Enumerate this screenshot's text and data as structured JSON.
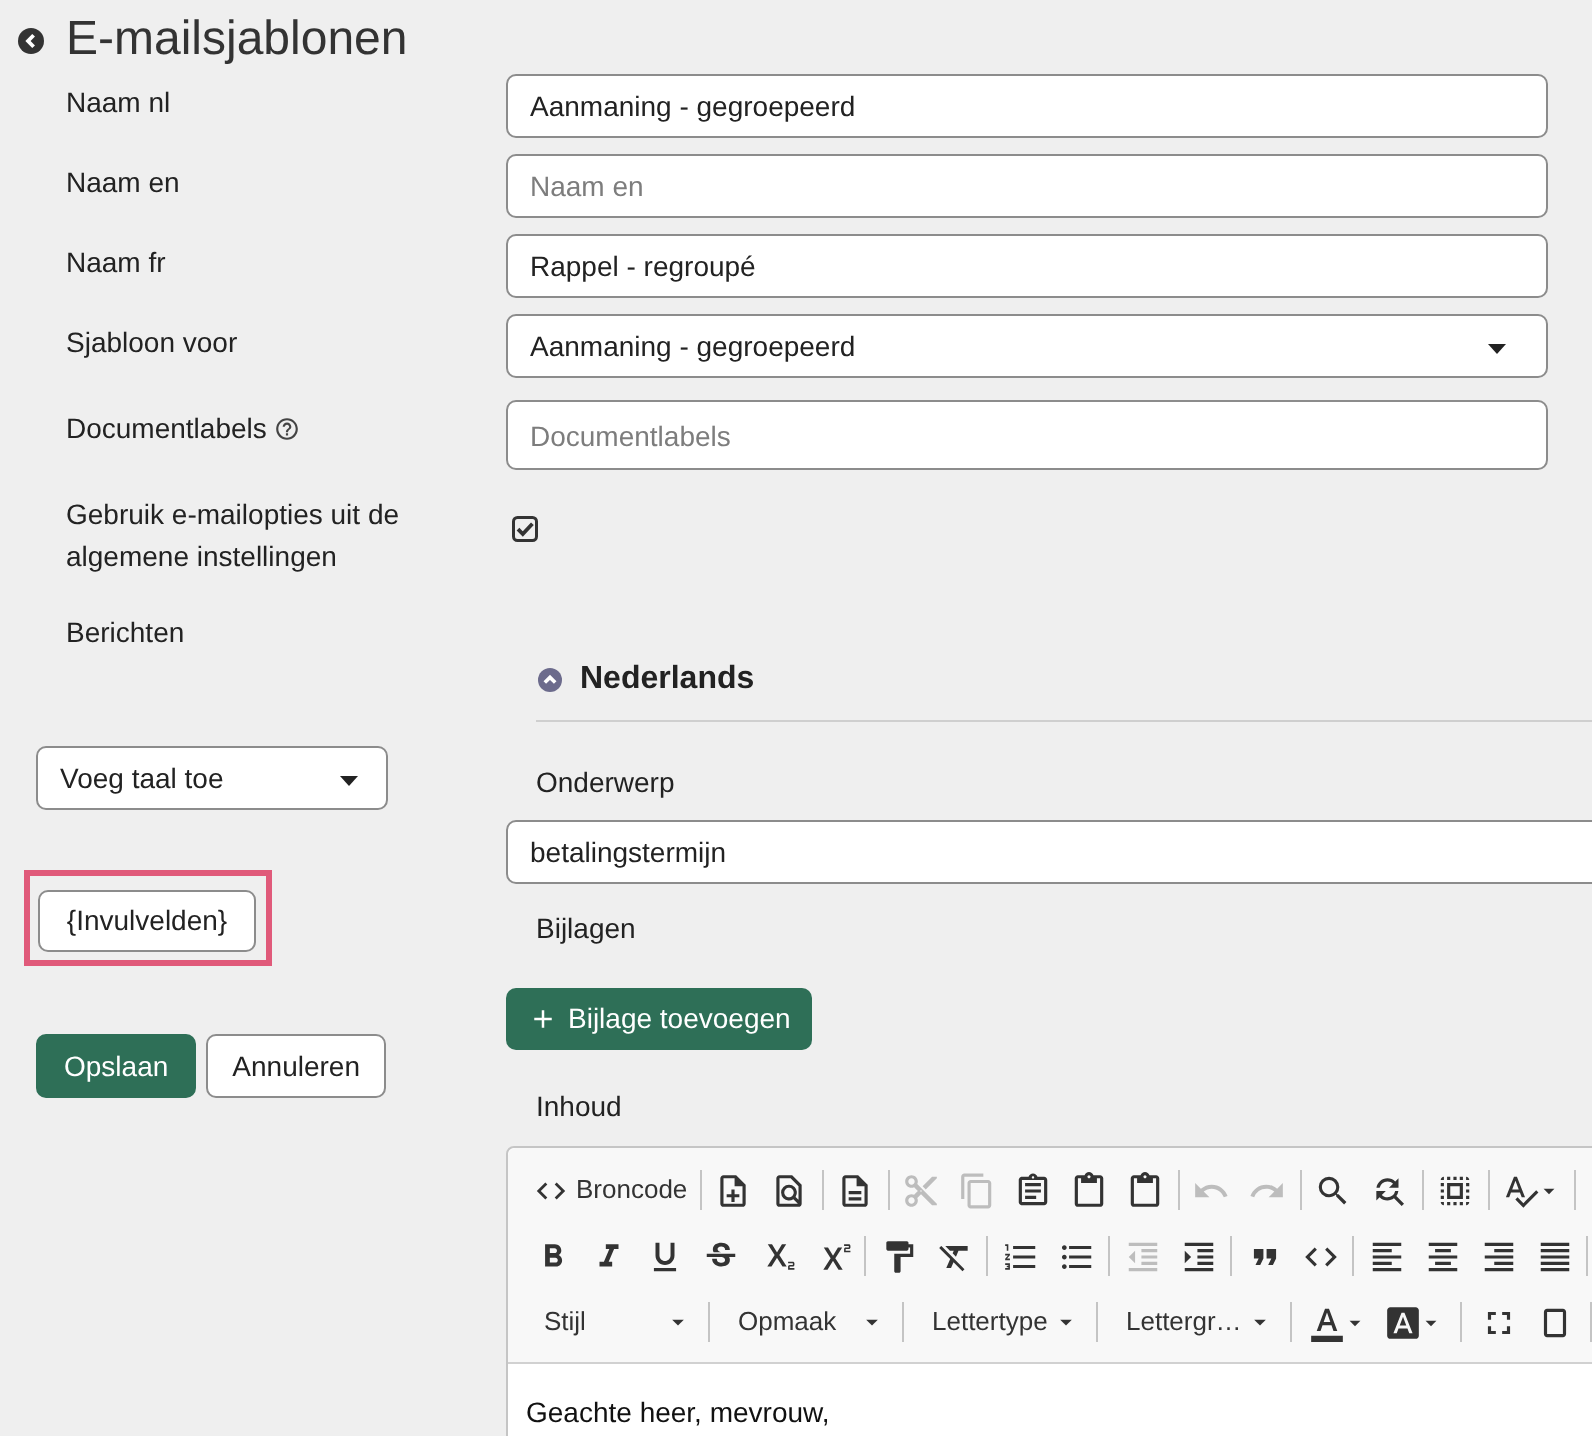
{
  "page": {
    "title": "E-mailsjablonen"
  },
  "form": {
    "fields": [
      {
        "kind": "text",
        "label": "Naam nl",
        "value": "Aanmaning - gegroepeerd"
      },
      {
        "kind": "text",
        "label": "Naam en",
        "placeholder": "Naam en"
      },
      {
        "kind": "text",
        "label": "Naam fr",
        "value": "Rappel - regroupé"
      },
      {
        "kind": "select",
        "label": "Sjabloon voor",
        "value": "Aanmaning - gegroepeerd"
      },
      {
        "kind": "tags",
        "label": "Documentlabels",
        "help": true,
        "placeholder": "Documentlabels"
      },
      {
        "kind": "checkbox",
        "label": "Gebruik e-mailopties uit de algemene instellingen",
        "checked": true
      }
    ],
    "messages_label": "Berichten"
  },
  "sidebar": {
    "language_select": {
      "value": "Voeg taal toe"
    },
    "placeholders_button": {
      "label": "{Invulvelden}",
      "highlighted": true
    },
    "actions": [
      {
        "kind": "primary",
        "label": "Opslaan"
      },
      {
        "kind": "secondary",
        "label": "Annuleren"
      }
    ]
  },
  "language_panel": {
    "title": "Nederlands",
    "expanded": true,
    "subject": {
      "label": "Onderwerp",
      "value": "betalingstermijn"
    },
    "attachments": {
      "label": "Bijlagen",
      "button": "Bijlage toevoegen"
    },
    "content": {
      "label": "Inhoud",
      "toolbar": [
        [
          [
            {
              "kind": "button",
              "label": "Broncode",
              "disabled": false
            }
          ],
          [
            {
              "kind": "button",
              "disabled": false
            },
            {
              "kind": "button",
              "disabled": false
            }
          ],
          [
            {
              "kind": "button",
              "disabled": false
            }
          ],
          [
            {
              "kind": "button",
              "disabled": true
            },
            {
              "kind": "button",
              "disabled": true
            },
            {
              "kind": "button",
              "disabled": false
            },
            {
              "kind": "button",
              "disabled": false
            },
            {
              "kind": "button",
              "disabled": false
            }
          ],
          [
            {
              "kind": "button",
              "disabled": true
            },
            {
              "kind": "button",
              "disabled": true
            }
          ],
          [
            {
              "kind": "button",
              "disabled": false
            },
            {
              "kind": "button",
              "disabled": false
            }
          ],
          [
            {
              "kind": "button",
              "disabled": false
            }
          ],
          [
            {
              "kind": "split",
              "disabled": false
            }
          ]
        ],
        [
          [
            {
              "kind": "button",
              "disabled": false
            },
            {
              "kind": "button",
              "disabled": false
            },
            {
              "kind": "button",
              "disabled": false
            },
            {
              "kind": "button",
              "disabled": false
            },
            {
              "kind": "button",
              "disabled": false
            },
            {
              "kind": "button",
              "disabled": false
            }
          ],
          [
            {
              "kind": "button",
              "disabled": false
            },
            {
              "kind": "button",
              "disabled": false
            }
          ],
          [
            {
              "kind": "button",
              "disabled": false
            },
            {
              "kind": "button",
              "disabled": false
            }
          ],
          [
            {
              "kind": "button",
              "disabled": true
            },
            {
              "kind": "button",
              "disabled": false
            }
          ],
          [
            {
              "kind": "button",
              "disabled": false
            },
            {
              "kind": "button",
              "disabled": false
            }
          ],
          [
            {
              "kind": "button",
              "disabled": false
            },
            {
              "kind": "button",
              "disabled": false
            },
            {
              "kind": "button",
              "disabled": false
            },
            {
              "kind": "button",
              "disabled": false
            }
          ]
        ],
        [
          [
            {
              "kind": "combo",
              "label": "Stijl",
              "disabled": false
            }
          ],
          [
            {
              "kind": "combo",
              "label": "Opmaak",
              "disabled": false
            }
          ],
          [
            {
              "kind": "combo",
              "label": "Lettertype",
              "disabled": false
            }
          ],
          [
            {
              "kind": "combo",
              "label": "Lettergr…",
              "disabled": false
            }
          ],
          [
            {
              "kind": "split",
              "disabled": false
            },
            {
              "kind": "split",
              "disabled": false
            }
          ],
          [
            {
              "kind": "button",
              "disabled": false
            },
            {
              "kind": "button",
              "disabled": false
            }
          ]
        ]
      ],
      "body": "Geachte heer, mevrouw,"
    }
  }
}
